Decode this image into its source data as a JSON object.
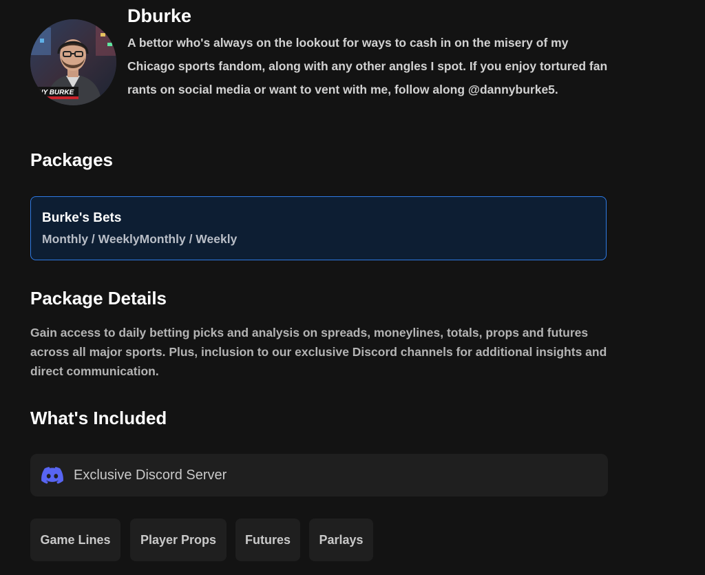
{
  "profile": {
    "username": "Dburke",
    "bio": "A bettor who's always on the lookout for ways to cash in on the misery of my Chicago sports fandom, along with any other angles I spot. If you enjoy tortured fan rants on social media or want to vent with me, follow along @dannyburke5.",
    "avatar_banner_text": "NNY BURKE"
  },
  "packages": {
    "title": "Packages",
    "items": [
      {
        "name": "Burke's Bets",
        "period": "Monthly / WeeklyMonthly / Weekly"
      }
    ]
  },
  "details": {
    "title": "Package Details",
    "text": "Gain access to daily betting picks and analysis on spreads, moneylines, totals, props and futures across all major sports. Plus, inclusion to our exclusive Discord channels for additional insights and direct communication."
  },
  "included": {
    "title": "What's Included",
    "discord": {
      "label": "Exclusive Discord Server",
      "icon": "discord-icon",
      "color": "#5865F2"
    },
    "tags": [
      "Game Lines",
      "Player Props",
      "Futures",
      "Parlays"
    ]
  },
  "colors": {
    "background": "#131313",
    "accent_border": "#2f7be6",
    "card_selected_bg": "#0d1e33",
    "panel_bg": "#1f1f1f"
  }
}
